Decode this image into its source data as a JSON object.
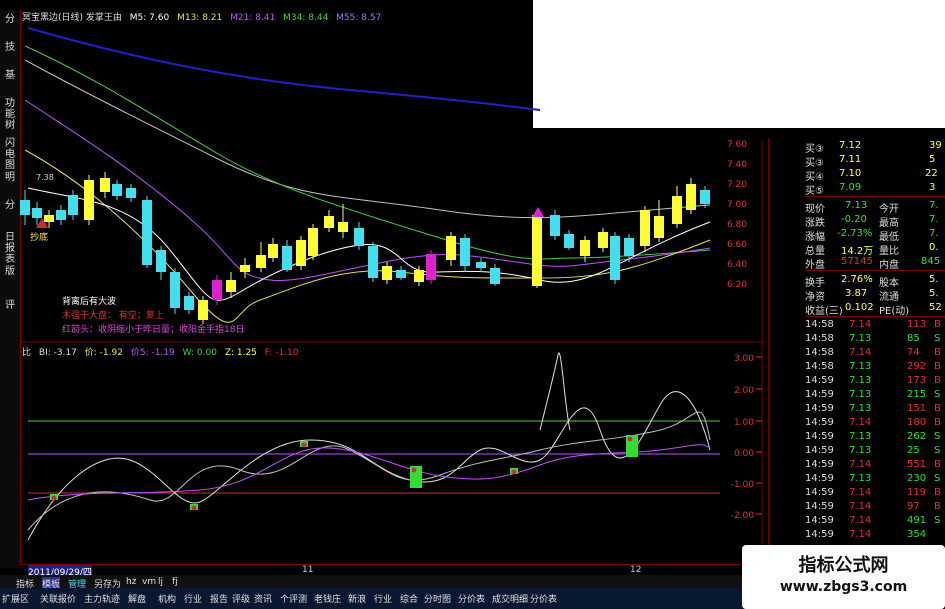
{
  "ma_line": {
    "label": "冥宝黑边(日线) 发掌王由",
    "ma5": "M5: 7.60",
    "ma13": "M13: 8.21",
    "ma21": "M21: 8.41",
    "ma34": "M34: 8.44",
    "ma55": "M55: 8.57"
  },
  "left_tabs": [
    "分",
    "技",
    "基",
    "功能树",
    "闪电图",
    "明",
    "分",
    "日报表",
    "版",
    "评"
  ],
  "price_marker": "7.38",
  "buy_marker": "抄底",
  "legend": {
    "line1": "背离后有大波",
    "line2_a": "木强于大盘：",
    "line2_b": "有空；复上",
    "line3": "红箭头：收阴缩小于昨日量；收阳金手指18日"
  },
  "indicator_line": {
    "name": "比",
    "bi": "BI: -3.17",
    "jia": "价: -1.92",
    "jia5": "价5: -1.19",
    "w": "W: 0.00",
    "z": "Z: 1.25",
    "f": "F: -1.10"
  },
  "price_axis": [
    "7.60",
    "7.40",
    "7.20",
    "7.00",
    "6.80",
    "6.60",
    "6.40",
    "6.20"
  ],
  "ind_axis": [
    "3.00",
    "2.00",
    "1.00",
    "0.00",
    "-1.00",
    "-2.00"
  ],
  "dates": {
    "start": "2011/09/29/四",
    "m1": "11",
    "m2": "12"
  },
  "order_book": [
    {
      "label": "买③",
      "price": "7.12",
      "vol": "39"
    },
    {
      "label": "买③",
      "price": "7.11",
      "vol": "5"
    },
    {
      "label": "买④",
      "price": "7.10",
      "vol": "22"
    },
    {
      "label": "买⑤",
      "price": "7.09",
      "vol": "3"
    }
  ],
  "quote": [
    {
      "k1": "现价",
      "v1": "7.13",
      "k2": "今开",
      "v2": "7."
    },
    {
      "k1": "涨跌",
      "v1": "-0.20",
      "k2": "最高",
      "v2": "7."
    },
    {
      "k1": "涨幅",
      "v1": "-2.73%",
      "k2": "最低",
      "v2": "7."
    },
    {
      "k1": "总量",
      "v1": "14.2万",
      "k2": "量比",
      "v2": "0."
    },
    {
      "k1": "外盘",
      "v1": "57145",
      "k2": "内盘",
      "v2": "845"
    },
    {
      "k1": "换手",
      "v1": "2.76%",
      "k2": "股本",
      "v2": "5."
    },
    {
      "k1": "净资",
      "v1": "3.87",
      "k2": "流通",
      "v2": "5."
    },
    {
      "k1": "收益(三)",
      "v1": "0.102",
      "k2": "PE(动)",
      "v2": "52"
    }
  ],
  "ticks": [
    {
      "t": "14:58",
      "p": "7.14",
      "v": "113",
      "d": "B"
    },
    {
      "t": "14:58",
      "p": "7.13",
      "v": "85",
      "d": "S"
    },
    {
      "t": "14:58",
      "p": "7.14",
      "v": "74",
      "d": "B"
    },
    {
      "t": "14:58",
      "p": "7.13",
      "v": "292",
      "d": "B"
    },
    {
      "t": "14:59",
      "p": "7.13",
      "v": "173",
      "d": "B"
    },
    {
      "t": "14:59",
      "p": "7.13",
      "v": "215",
      "d": "S"
    },
    {
      "t": "14:59",
      "p": "7.13",
      "v": "151",
      "d": "B"
    },
    {
      "t": "14:59",
      "p": "7.14",
      "v": "180",
      "d": "B"
    },
    {
      "t": "14:59",
      "p": "7.13",
      "v": "262",
      "d": "S"
    },
    {
      "t": "14:59",
      "p": "7.13",
      "v": "25",
      "d": "S"
    },
    {
      "t": "14:59",
      "p": "7.14",
      "v": "551",
      "d": "B"
    },
    {
      "t": "14:59",
      "p": "7.13",
      "v": "230",
      "d": "S"
    },
    {
      "t": "14:59",
      "p": "7.14",
      "v": "119",
      "d": "B"
    },
    {
      "t": "14:59",
      "p": "7.14",
      "v": "97",
      "d": "B"
    },
    {
      "t": "14:59",
      "p": "7.14",
      "v": "491",
      "d": "S"
    },
    {
      "t": "14:59",
      "p": "7.14",
      "v": "354",
      "d": ""
    }
  ],
  "bottom_tabs": [
    "指标",
    "模板",
    "管理",
    "另存为",
    "hz",
    "vm",
    "lj",
    "fj"
  ],
  "bottom_menu": [
    "扩展区",
    "关联报价",
    "主力轨迹",
    "解盘",
    "机构",
    "行业",
    "报告",
    "评级",
    "资讯",
    "个评测",
    "老钱庄",
    "新浪",
    "行业",
    "综合",
    "分时图",
    "分价表",
    "成交明细",
    "分价表"
  ],
  "watermark": {
    "title": "指标公式网",
    "url": "www.zbgs3.com"
  },
  "colors": {
    "up_candle": "#ffff30",
    "down_candle": "#40e0f0",
    "magenta_candle": "#e020d0",
    "ma5": "#ffffff",
    "ma13": "#e8e050",
    "ma21": "#c050ff",
    "ma34": "#40d040",
    "ma55": "#2020c8",
    "panel_red": "#c83030",
    "panel_green": "#30e030",
    "panel_yellow": "#ffff40"
  }
}
